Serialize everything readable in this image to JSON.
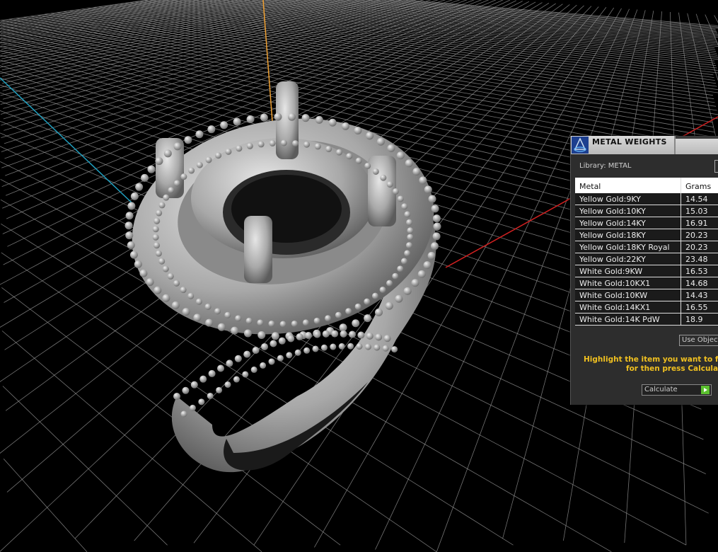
{
  "panel": {
    "title": "METAL WEIGHTS",
    "library_label": "Library: METAL",
    "columns": [
      "Metal",
      "Grams"
    ],
    "rows": [
      {
        "metal": "Yellow Gold:9KY",
        "grams": "14.54"
      },
      {
        "metal": "Yellow Gold:10KY",
        "grams": "15.03"
      },
      {
        "metal": "Yellow Gold:14KY",
        "grams": "16.91"
      },
      {
        "metal": "Yellow Gold:18KY",
        "grams": "20.23"
      },
      {
        "metal": "Yellow Gold:18KY Royal",
        "grams": "20.23"
      },
      {
        "metal": "Yellow Gold:22KY",
        "grams": "23.48"
      },
      {
        "metal": "White Gold:9KW",
        "grams": "16.53"
      },
      {
        "metal": "White Gold:10KX1",
        "grams": "14.68"
      },
      {
        "metal": "White Gold:10KW",
        "grams": "14.43"
      },
      {
        "metal": "White Gold:14KX1",
        "grams": "16.55"
      },
      {
        "metal": "White Gold:14K PdW",
        "grams": "18.9"
      }
    ],
    "use_object_label": "Use Object",
    "hint_line1": "Highlight the item you want to find",
    "hint_line2": "for then press Calculate",
    "calculate_label": "Calculate"
  },
  "colors": {
    "grid": "#9a9a9a",
    "axis_x": "#d02020",
    "axis_y": "#f0a030",
    "axis_z": "#20a0c0",
    "hint": "#f0c020",
    "accent": "#5bc02f"
  }
}
